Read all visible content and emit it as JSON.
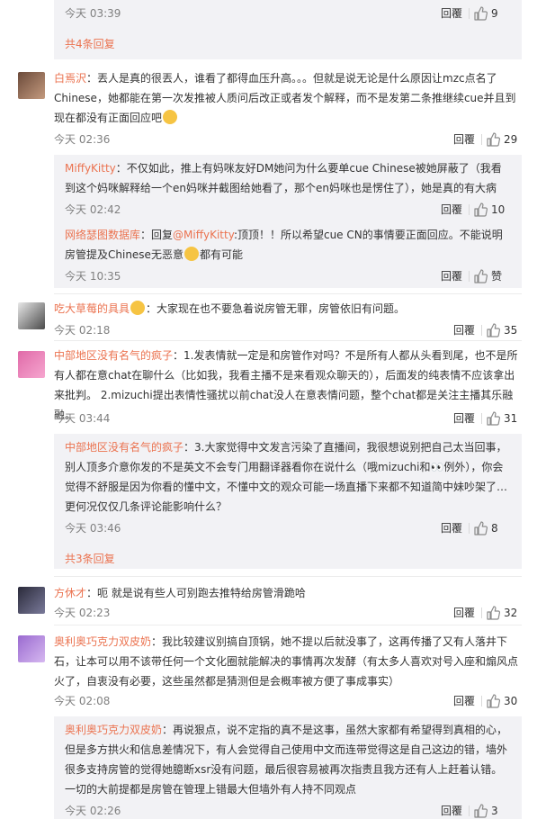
{
  "ui": {
    "reply_label": "回覆",
    "like_icon": "thumb-up-icon",
    "accent_color": "#eb7350"
  },
  "top": {
    "time": "今天 03:39",
    "likes": "9",
    "more": "共4条回复"
  },
  "comments": [
    {
      "name": "白焉沢",
      "text": "：丟人是真的很丟人，谁看了都得血压升高。。。但就是说无论是什么原因让mzc点名了Chinese，她都能在第一次发推被人质问后改正或者发个解释，而不是发第二条推继续cue并且到现在都没有正面回应吧",
      "time": "今天 02:36",
      "likes": "29",
      "replies": [
        {
          "name": "MiffyKitty",
          "text": "：不仅如此，推上有妈咪友好DM她问为什么要单cue Chinese被她屏蔽了（我看到这个妈咪解释给一个en妈咪并截图给她看了，那个en妈咪也是愣住了），她是真的有大病",
          "time": "今天 02:42",
          "likes": "10"
        },
        {
          "name": "网络瑟图数据库",
          "pre": "：回复",
          "mention": "@MiffyKitty",
          "text": ":顶顶！！所以希望cue CN的事情要正面回应。不能说明房管提及Chinese无恶意",
          "text2": "都有可能",
          "time": "今天 10:35",
          "likes": "赞"
        }
      ]
    },
    {
      "name": "吃大草莓的具具",
      "text": "：大家现在也不要急着说房管无罪，房管依旧有问题。",
      "time": "今天 02:18",
      "likes": "35"
    },
    {
      "name": "中部地区没有名气的疯子",
      "text": "：1.发表情就一定是和房管作对吗？不是所有人都从头看到尾，也不是所有人都在意chat在聊什么（比如我，我看主播不是来看观众聊天的），后面发的纯表情不应该拿出来批判。 2.mizuchi提出表情性骚扰以前chat没人在意表情问题，整个chat都是关注主播其乐融融。",
      "time": "今天 03:44",
      "likes": "31",
      "replies": [
        {
          "name": "中部地区没有名气的疯子",
          "text": "：3.大家觉得中文发言污染了直播间，我很想说别把自己太当回事，别人顶多介意你发的不是英文不会专门用翻译器看你在说什么（哦mizuchi和👀例外），你会觉得不舒服是因为你看的懂中文，不懂中文的观众可能一场直播下来都不知道简中妹吵架了…更何况仅仅几条评论能影响什么？",
          "time": "今天 03:46",
          "likes": "8"
        }
      ],
      "more": "共3条回复"
    },
    {
      "name": "方休才",
      "text": "：呃 就是说有些人可别跑去推特给房管滑跪哈",
      "time": "今天 02:23",
      "likes": "32"
    },
    {
      "name": "奥利奥巧克力双皮奶",
      "text": "：我比较建议别搞自顶锅，她不提以后就没事了，这再传播了又有人落井下石，让本可以用不该带任何一个文化圈就能解决的事情再次发酵（有太多人喜欢对号入座和煽风点火了，自衷没有必要，这些虽然都是猜测但是会概率被方便了事成事实）",
      "time": "今天 02:08",
      "likes": "30",
      "replies": [
        {
          "name": "奥利奥巧克力双皮奶",
          "text": "：再说狠点，说不定指的真不是这事，虽然大家都有希望得到真相的心，但是多方拱火和信息差情况下，有人会觉得自己使用中文而连带觉得这是自己这边的错，墙外很多支持房管的觉得她臆断xsr没有问题，最后很容易被再次指责且我方还有人上赶着认错。一切的大前提都是房管在管理上错最大但墙外有人持不同观点",
          "time": "今天 02:26",
          "likes": "3"
        }
      ]
    }
  ]
}
